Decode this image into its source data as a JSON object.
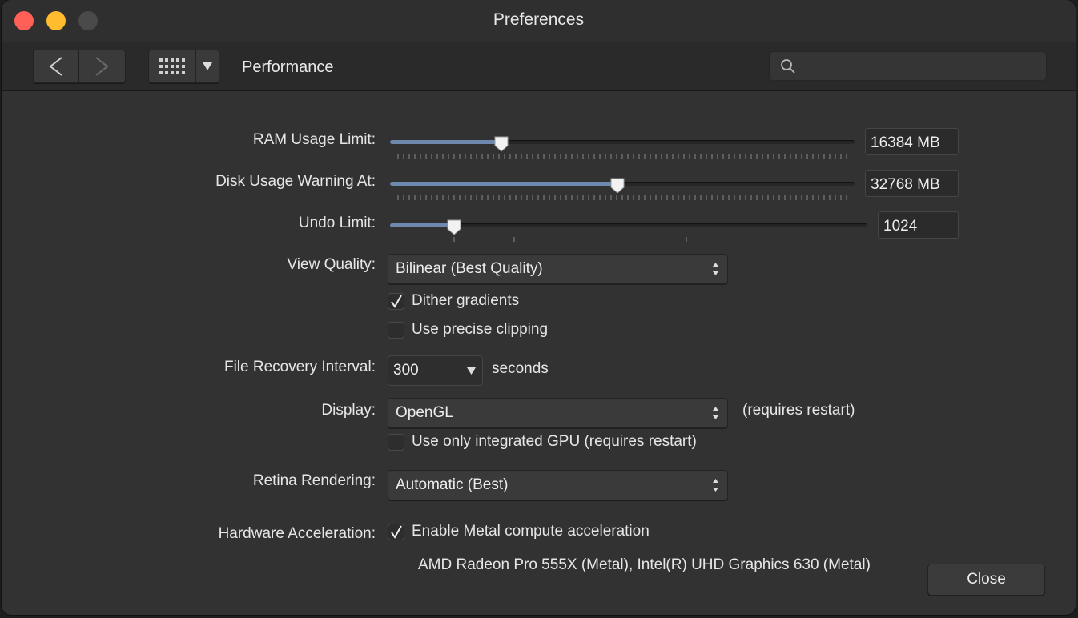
{
  "window": {
    "title": "Preferences"
  },
  "toolbar": {
    "section_title": "Performance",
    "search": {
      "value": "",
      "placeholder": ""
    }
  },
  "icons": {
    "back": "chevron-left-icon",
    "forward": "chevron-right-icon",
    "grid": "grid-icon",
    "menu": "triangle-down-icon",
    "search": "search-icon"
  },
  "colors": {
    "close": "#fe5f57",
    "minimize": "#febc2e",
    "slider_fill": "#6f88ad",
    "window_bg": "#323232"
  },
  "ram_limit": {
    "label": "RAM Usage Limit:",
    "value": "16384 MB",
    "fraction": 0.24
  },
  "disk_warning": {
    "label": "Disk Usage Warning At:",
    "value": "32768 MB",
    "fraction": 0.49
  },
  "undo_limit": {
    "label": "Undo Limit:",
    "value": "1024",
    "fraction": 0.135
  },
  "view_quality": {
    "label": "View Quality:",
    "value": "Bilinear (Best Quality)"
  },
  "dither": {
    "label": "Dither gradients",
    "checked": true
  },
  "precise_clipping": {
    "label": "Use precise clipping",
    "checked": false
  },
  "file_recovery": {
    "label": "File Recovery Interval:",
    "value": "300",
    "unit": "seconds"
  },
  "display": {
    "label": "Display:",
    "value": "OpenGL",
    "note": "(requires restart)"
  },
  "integrated_gpu": {
    "label": "Use only integrated GPU (requires restart)",
    "checked": false
  },
  "retina": {
    "label": "Retina Rendering:",
    "value": "Automatic (Best)"
  },
  "hardware_accel": {
    "label": "Hardware Acceleration:",
    "checkbox_label": "Enable Metal compute acceleration",
    "checked": true,
    "gpu_list": "AMD Radeon Pro 555X (Metal), Intel(R) UHD Graphics 630 (Metal)"
  },
  "buttons": {
    "close": "Close"
  }
}
